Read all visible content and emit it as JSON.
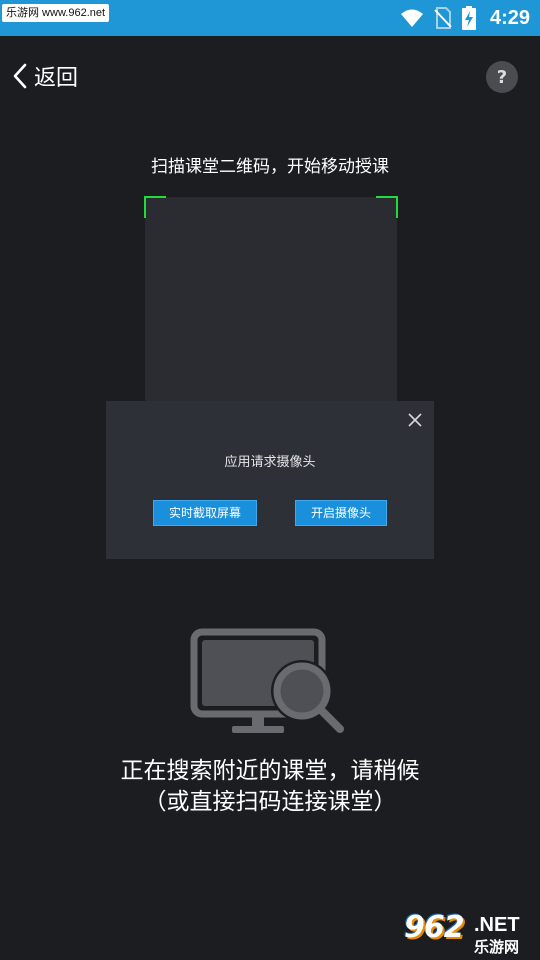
{
  "status_bar": {
    "watermark": "乐游网 www.962.net",
    "time": "4:29",
    "icons": [
      "wifi-icon",
      "no-sim-icon",
      "battery-charging-icon"
    ],
    "color": "#1f97d6"
  },
  "nav": {
    "back_label": "返回",
    "help_label": "?"
  },
  "scan": {
    "title": "扫描课堂二维码，开始移动授课",
    "corner_color": "#1fdc3a"
  },
  "dialog": {
    "message": "应用请求摄像头",
    "btn_screen_capture": "实时截取屏幕",
    "btn_open_camera": "开启摄像头",
    "button_color": "#1a8fdb"
  },
  "searching": {
    "line1": "正在搜索附近的课堂，请稍候",
    "line2": "（或直接扫码连接课堂）"
  },
  "watermark_bottom": {
    "number": "962",
    "suffix": ".NET",
    "sub": "乐游网"
  }
}
